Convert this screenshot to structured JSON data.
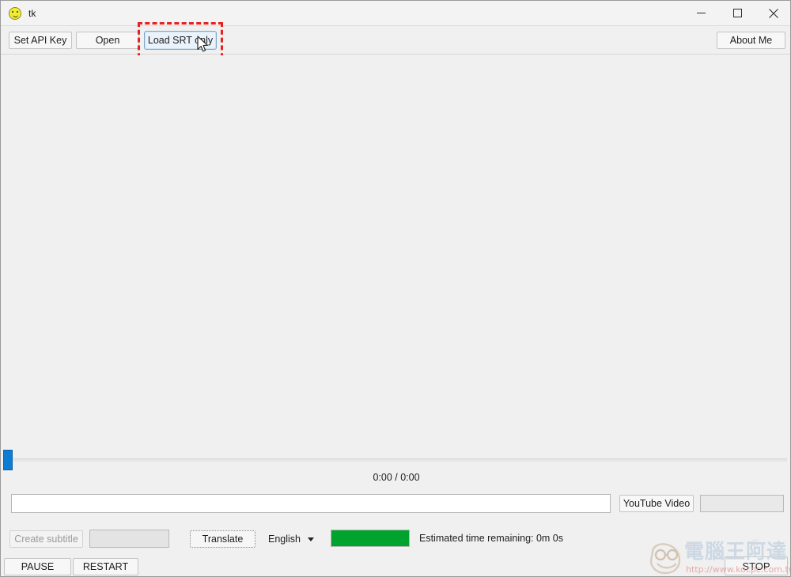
{
  "window": {
    "title": "tk",
    "icon": "smiley-face-icon",
    "controls": {
      "minimize": "minimize-icon",
      "maximize": "maximize-icon",
      "close": "close-icon"
    }
  },
  "toolbar": {
    "set_api_key": "Set API Key",
    "open": "Open",
    "load_srt_only": "Load SRT only",
    "about_me": "About Me"
  },
  "annotation": {
    "color": "#e8201e",
    "target": "Load SRT only"
  },
  "player": {
    "time_label": "0:00 / 0:00",
    "seek_value": 0,
    "seek_thumb_color": "#0c7cd5"
  },
  "url_row": {
    "url_value": "",
    "youtube_button": "YouTube Video",
    "srt_field_value": ""
  },
  "actions": {
    "create_subtitle": "Create subtitle",
    "create_subtitle_enabled": false,
    "subtitle_field_value": "",
    "translate": "Translate",
    "language_selected": "English",
    "language_caret": "chevron-down-icon",
    "progress_percent": 100,
    "progress_color": "#00a32e",
    "eta_label": "Estimated time remaining: 0m 0s"
  },
  "bottom": {
    "pause": "PAUSE",
    "restart": "RESTART",
    "stop": "STOP"
  },
  "watermark": {
    "brand_cjk": "電腦王阿達",
    "url": "http://www.kocpc.com.tw",
    "crown": "♕"
  }
}
